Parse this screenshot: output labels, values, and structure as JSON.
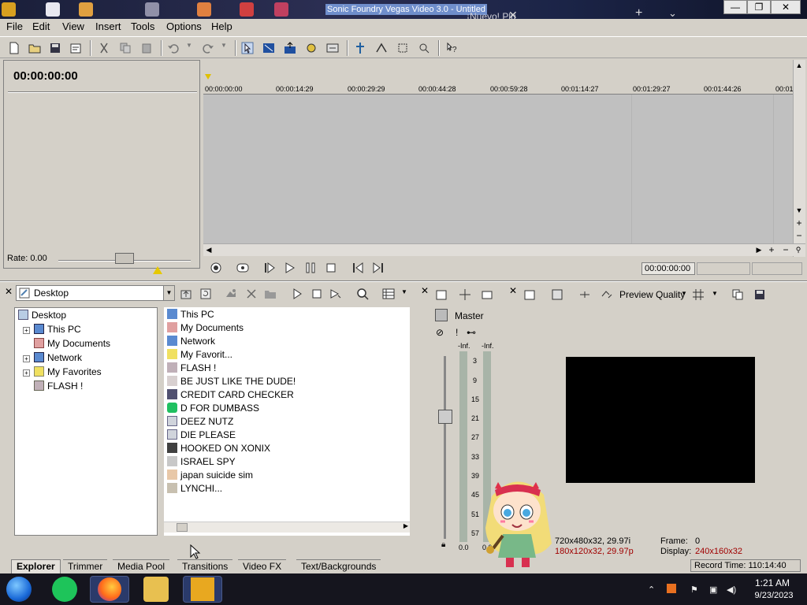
{
  "window": {
    "title": "Sonic Foundry Vegas Video 3.0 - Untitled",
    "tab_label": "¡Nuevo! Plu",
    "min_label": "—",
    "max_label": "❐",
    "close_label": "✕"
  },
  "menu": [
    "File",
    "Edit",
    "View",
    "Insert",
    "Tools",
    "Options",
    "Help"
  ],
  "timecode": "00:00:00:00",
  "rate_label": "Rate: 0.00",
  "ruler_labels": [
    "00:00:00:00",
    "00:00:14:29",
    "00:00:29:29",
    "00:00:44:28",
    "00:00:59:28",
    "00:01:14:27",
    "00:01:29:27",
    "00:01:44:26",
    "00:01"
  ],
  "transport_time": "00:00:00:00",
  "explorer": {
    "location": "Desktop",
    "tree": [
      "Desktop",
      "This PC",
      "My Documents",
      "Network",
      "My Favorites",
      "FLASH !"
    ],
    "files": [
      "This PC",
      "My Documents",
      "Network",
      "My Favorit...",
      "FLASH !",
      "BE JUST LIKE THE DUDE!",
      "CREDIT CARD CHECKER",
      "D FOR DUMBASS",
      "DEEZ NUTZ",
      "DIE PLEASE",
      "HOOKED ON XONIX",
      "ISRAEL SPY",
      "japan suicide sim",
      "LYNCHI..."
    ]
  },
  "tabs": [
    "Explorer",
    "Trimmer",
    "Media Pool",
    "Transitions",
    "Video FX",
    "Text/Backgrounds"
  ],
  "mixer": {
    "master_label": "Master",
    "peak_left": "-Inf.",
    "peak_right": "-Inf.",
    "scale": [
      "3",
      "9",
      "15",
      "21",
      "27",
      "33",
      "39",
      "45",
      "51",
      "57"
    ],
    "bottom_left": "0.0",
    "bottom_right": "0.0"
  },
  "preview": {
    "quality_label": "Preview Quality",
    "project_info": "720x480x32, 29.97i",
    "preview_info": "180x120x32, 29.97p",
    "frame_label": "Frame:",
    "frame_value": "0",
    "display_label": "Display:",
    "display_value": "240x160x32"
  },
  "record_time": "Record Time: 110:14:40",
  "taskbar": {
    "time": "1:21 AM",
    "date": "9/23/2023"
  },
  "colors": {
    "app_bg": "#d4d0c8",
    "title_highlight": "#6f8ecb",
    "preview_red": "#a00000",
    "taskbar_bg": "#15151e"
  }
}
